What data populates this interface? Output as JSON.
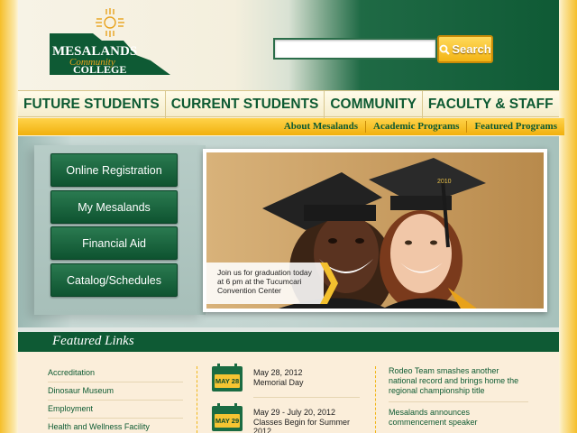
{
  "header": {
    "logo_text": "MESALANDS Community COLLEGE",
    "search": {
      "placeholder": "",
      "value": "",
      "button_label": "Search"
    }
  },
  "main_nav": [
    {
      "label": "FUTURE STUDENTS"
    },
    {
      "label": "CURRENT STUDENTS"
    },
    {
      "label": "COMMUNITY"
    },
    {
      "label": "FACULTY & STAFF"
    }
  ],
  "sub_nav": [
    {
      "label": "About Mesalands"
    },
    {
      "label": "Academic Programs"
    },
    {
      "label": "Featured Programs"
    }
  ],
  "quick_links": [
    {
      "label": "Online Registration"
    },
    {
      "label": "My Mesalands"
    },
    {
      "label": "Financial Aid"
    },
    {
      "label": "Catalog/Schedules"
    }
  ],
  "feature": {
    "caption": "Join us for graduation today at 6 pm at the Tucumcari Convention Center",
    "cap_tassel_text": "2010"
  },
  "featured_links": {
    "title": "Featured Links",
    "links": [
      {
        "label": "Accreditation"
      },
      {
        "label": "Dinosaur Museum"
      },
      {
        "label": "Employment"
      },
      {
        "label": "Health and Wellness Facility"
      }
    ]
  },
  "events": [
    {
      "badge": "MAY 28",
      "date": "May 28, 2012",
      "title": "Memorial Day"
    },
    {
      "badge": "MAY 29",
      "date": "May 29 - July 20, 2012",
      "title": "Classes Begin for Summer 2012"
    }
  ],
  "news": [
    {
      "text": "Rodeo Team smashes another national record and brings home the regional championship title"
    },
    {
      "text": "Mesalands announces commencement speaker"
    }
  ],
  "colors": {
    "brand_green": "#0e5a34",
    "brand_gold": "#f6bf2a",
    "cream": "#fbeeda"
  }
}
